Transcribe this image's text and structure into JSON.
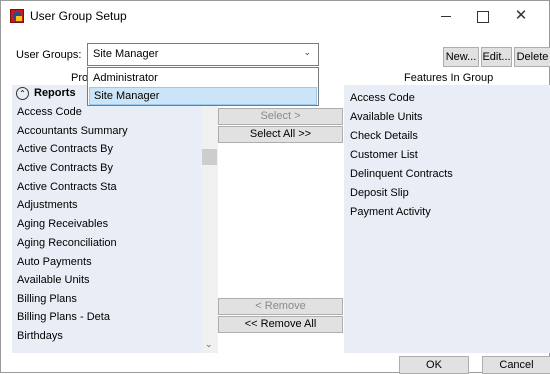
{
  "window": {
    "title": "User Group Setup"
  },
  "user_groups": {
    "label": "User Groups:",
    "selected": "Site Manager",
    "options": [
      "Administrator",
      "Site Manager"
    ]
  },
  "toolbar": {
    "new_label": "New...",
    "edit_label": "Edit...",
    "delete_label": "Delete"
  },
  "left_panel": {
    "header": "Pro",
    "group_label": "Reports",
    "items": [
      "Access Code",
      "Accountants Summary",
      "Active Contracts By",
      "Active Contracts By",
      "Active Contracts Sta",
      "Adjustments",
      "Aging Receivables",
      "Aging Reconciliation",
      "Auto Payments",
      "Available Units",
      "Billing Plans",
      "Billing Plans - Deta",
      "Birthdays"
    ]
  },
  "middle": {
    "select_label": "Select >",
    "select_all_label": "Select All >>",
    "remove_label": "< Remove",
    "remove_all_label": "<< Remove All"
  },
  "right_panel": {
    "header": "Features In Group",
    "items": [
      "Access Code",
      "Available Units",
      "Check Details",
      "Customer List",
      "Delinquent Contracts",
      "Deposit Slip",
      "Payment Activity"
    ]
  },
  "footer": {
    "ok_label": "OK",
    "cancel_label": "Cancel"
  }
}
